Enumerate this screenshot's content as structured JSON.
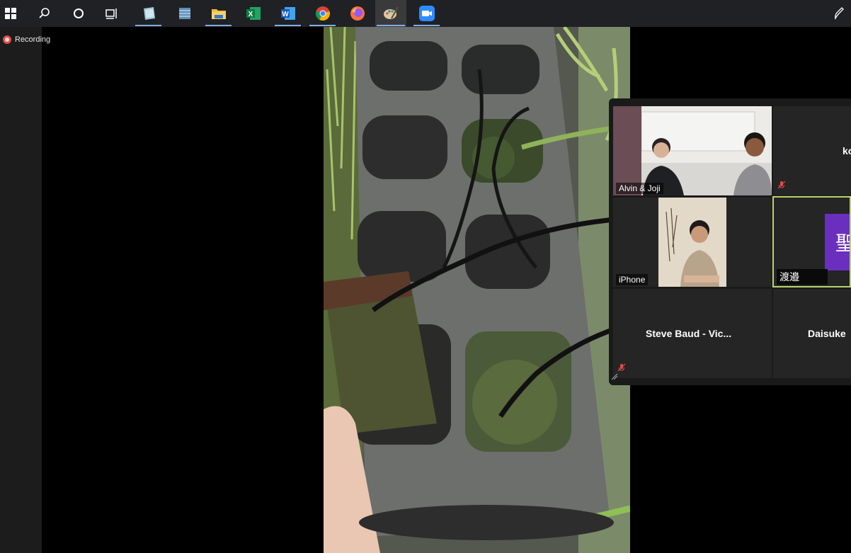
{
  "taskbar": {
    "items": [
      {
        "name": "windows-start",
        "icon": "windows-logo-icon"
      },
      {
        "name": "search",
        "icon": "search-icon"
      },
      {
        "name": "cortana",
        "icon": "circle-icon"
      },
      {
        "name": "task-view",
        "icon": "task-view-icon"
      },
      {
        "name": "notes-app",
        "icon": "notebook-icon",
        "active": true
      },
      {
        "name": "files-app",
        "icon": "stack-icon"
      },
      {
        "name": "file-explorer",
        "icon": "folder-icon",
        "active": true
      },
      {
        "name": "excel",
        "icon": "excel-icon",
        "letter": "X"
      },
      {
        "name": "word",
        "icon": "word-icon",
        "letter": "W",
        "active": true
      },
      {
        "name": "chrome",
        "icon": "chrome-icon",
        "active": true
      },
      {
        "name": "firefox",
        "icon": "firefox-icon"
      },
      {
        "name": "paint",
        "icon": "paint-palette-icon",
        "active": true
      },
      {
        "name": "zoom",
        "icon": "zoom-video-icon",
        "active": true
      },
      {
        "name": "pen",
        "icon": "pen-icon"
      }
    ]
  },
  "recording": {
    "label": "Recording",
    "color": "#e34b4b"
  },
  "gallery": {
    "tiles": [
      {
        "name": "Alvin & Joji",
        "muted": false
      },
      {
        "name": "ko",
        "muted": true
      },
      {
        "name": "iPhone",
        "muted": false
      },
      {
        "name": "渡邉",
        "avatar_letter": "聖",
        "avatar_color": "#6a2fbf",
        "active_speaker": true
      },
      {
        "name": "Steve Baud - Vic...",
        "muted": true
      },
      {
        "name": "Daisuke"
      }
    ]
  },
  "colors": {
    "taskbar": "#202124",
    "active_indicator": "#7fb0e6",
    "active_speaker_border": "#b8d66a",
    "mute": "#e34b4b"
  }
}
